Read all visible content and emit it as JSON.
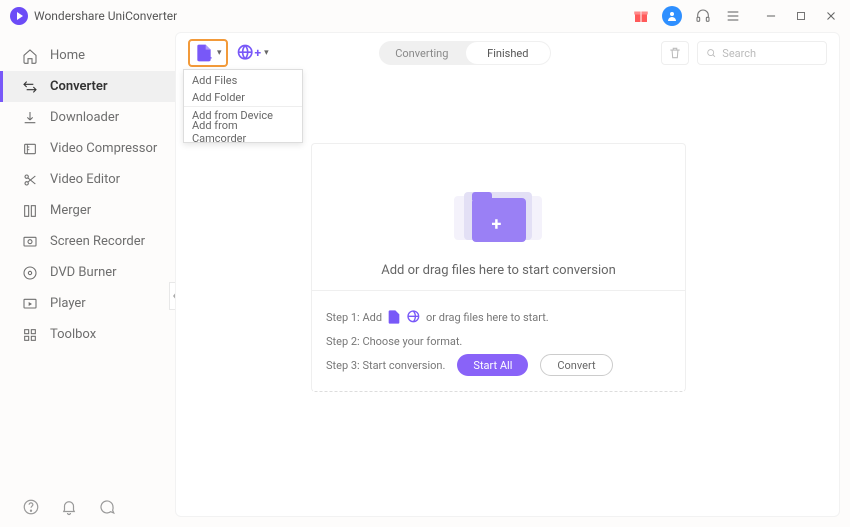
{
  "app": {
    "title": "Wondershare UniConverter"
  },
  "titlebar_icons": [
    "gift",
    "profile",
    "headset",
    "menu",
    "minimize",
    "maximize",
    "close"
  ],
  "sidebar": {
    "items": [
      {
        "label": "Home",
        "icon": "home"
      },
      {
        "label": "Converter",
        "icon": "convert",
        "active": true
      },
      {
        "label": "Downloader",
        "icon": "download"
      },
      {
        "label": "Video Compressor",
        "icon": "compress"
      },
      {
        "label": "Video Editor",
        "icon": "scissors"
      },
      {
        "label": "Merger",
        "icon": "merge"
      },
      {
        "label": "Screen Recorder",
        "icon": "record"
      },
      {
        "label": "DVD Burner",
        "icon": "disc"
      },
      {
        "label": "Player",
        "icon": "play"
      },
      {
        "label": "Toolbox",
        "icon": "grid"
      }
    ],
    "bottom_icons": [
      "help",
      "bell",
      "chat"
    ]
  },
  "toolbar": {
    "tabs": {
      "converting": "Converting",
      "finished": "Finished",
      "active": "finished"
    },
    "search_placeholder": "Search"
  },
  "dropdown": {
    "items": [
      {
        "label": "Add Files"
      },
      {
        "label": "Add Folder"
      },
      {
        "label": "Add from Device",
        "sep": true
      },
      {
        "label": "Add from Camcorder"
      }
    ]
  },
  "dropzone": {
    "text": "Add or drag files here to start conversion"
  },
  "steps": {
    "s1a": "Step 1: Add",
    "s1b": "or drag files here to start.",
    "s2": "Step 2: Choose your format.",
    "s3": "Step 3: Start conversion.",
    "start_all": "Start All",
    "convert": "Convert"
  }
}
